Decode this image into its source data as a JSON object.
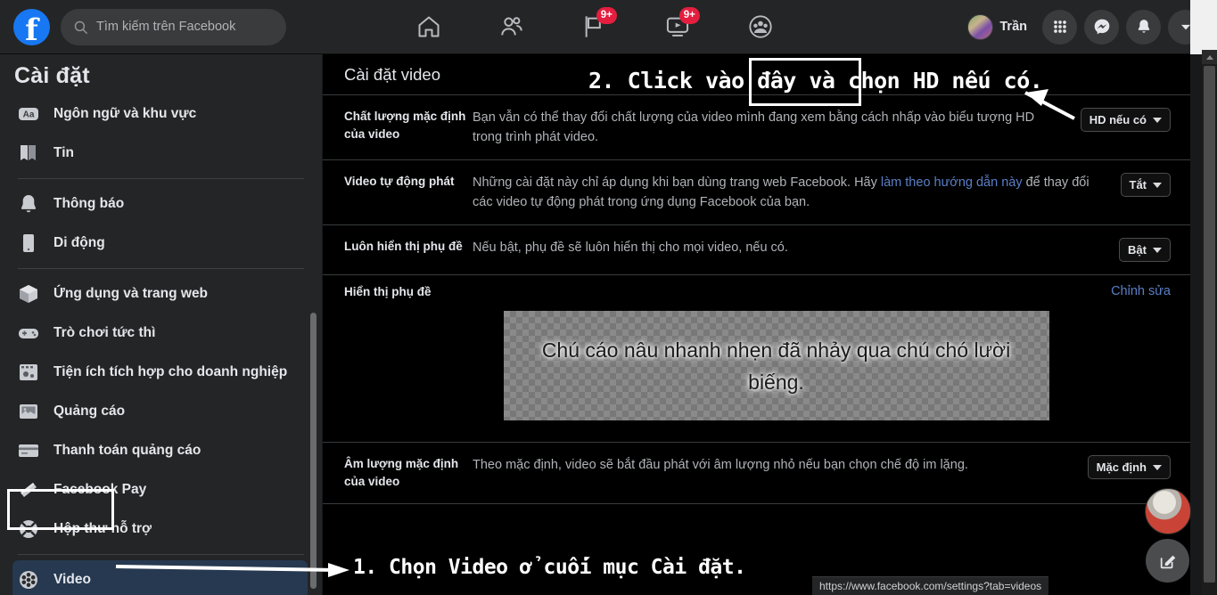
{
  "header": {
    "logo_letter": "f",
    "search": {
      "placeholder": "Tìm kiếm trên Facebook",
      "icon": "search-icon"
    },
    "nav": [
      {
        "name": "home",
        "icon": "home-icon",
        "badge": ""
      },
      {
        "name": "friends",
        "icon": "friends-icon",
        "badge": ""
      },
      {
        "name": "marketplace",
        "icon": "flag-icon",
        "badge": "9+"
      },
      {
        "name": "watch",
        "icon": "video-screen-icon",
        "badge": "9+"
      },
      {
        "name": "groups",
        "icon": "groups-icon",
        "badge": ""
      }
    ],
    "profile_name": "Trần",
    "actions": [
      {
        "name": "menu-grid",
        "icon": "grid-icon"
      },
      {
        "name": "messenger",
        "icon": "messenger-icon"
      },
      {
        "name": "notifications",
        "icon": "bell-icon"
      },
      {
        "name": "account",
        "icon": "chevron-down-icon"
      }
    ]
  },
  "sidebar": {
    "title": "Cài đặt",
    "items": [
      {
        "label": "Ngôn ngữ và khu vực",
        "icon": "language-icon",
        "active": false
      },
      {
        "label": "Tin",
        "icon": "news-book-icon",
        "active": false
      },
      {
        "label": "Thông báo",
        "icon": "bell-icon",
        "active": false
      },
      {
        "label": "Di động",
        "icon": "mobile-phone-icon",
        "active": false
      },
      {
        "label": "Ứng dụng và trang web",
        "icon": "apps-cube-icon",
        "active": false
      },
      {
        "label": "Trò chơi tức thì",
        "icon": "gamepad-icon",
        "active": false
      },
      {
        "label": "Tiện ích tích hợp cho doanh nghiệp",
        "icon": "business-integration-icon",
        "active": false
      },
      {
        "label": "Quảng cáo",
        "icon": "ads-icon",
        "active": false
      },
      {
        "label": "Thanh toán quảng cáo",
        "icon": "credit-card-icon",
        "active": false
      },
      {
        "label": "Facebook Pay",
        "icon": "facebook-pay-icon",
        "active": false
      },
      {
        "label": "Hộp thư hỗ trợ",
        "icon": "support-lifebuoy-icon",
        "active": false
      },
      {
        "label": "Video",
        "icon": "film-reel-icon",
        "active": true
      }
    ]
  },
  "main": {
    "title": "Cài đặt video",
    "rows": [
      {
        "label": "Chất lượng mặc định của video",
        "desc_before": "Bạn vẫn có thể thay đổi chất lượng của video mình đang xem bằng cách nhấp vào biểu tượng HD trong trình phát video.",
        "link": "",
        "desc_after": "",
        "control": "HD nếu có"
      },
      {
        "label": "Video tự động phát",
        "desc_before": "Những cài đặt này chỉ áp dụng khi bạn dùng trang web Facebook. Hãy ",
        "link": "làm theo hướng dẫn này",
        "desc_after": " để thay đổi các video tự động phát trong ứng dụng Facebook của bạn.",
        "control": "Tắt"
      },
      {
        "label": "Luôn hiển thị phụ đề",
        "desc_before": "Nếu bật, phụ đề sẽ luôn hiển thị cho mọi video, nếu có.",
        "link": "",
        "desc_after": "",
        "control": "Bật"
      }
    ],
    "caption_section": {
      "label": "Hiển thị phụ đề",
      "edit_link": "Chỉnh sửa",
      "preview_text": "Chú cáo nâu nhanh nhẹn đã nhảy qua chú chó lười biếng."
    },
    "volume_row": {
      "label": "Âm lượng mặc định của video",
      "desc": "Theo mặc định, video sẽ bắt đầu phát với âm lượng nhỏ nếu bạn chọn chế độ im lặng.",
      "control": "Mặc định"
    }
  },
  "annotations": {
    "step2": "2. Click vào đây và chọn HD nếu có.",
    "step1": "1. Chọn Video ở cuối mục Cài đặt."
  },
  "statusbar": {
    "url": "https://www.facebook.com/settings?tab=videos"
  },
  "colors": {
    "brand": "#1877f2",
    "badge": "#e41e3f",
    "link": "#5b7fc7",
    "panel": "#242526",
    "content": "#000000",
    "active_item": "#263951"
  }
}
